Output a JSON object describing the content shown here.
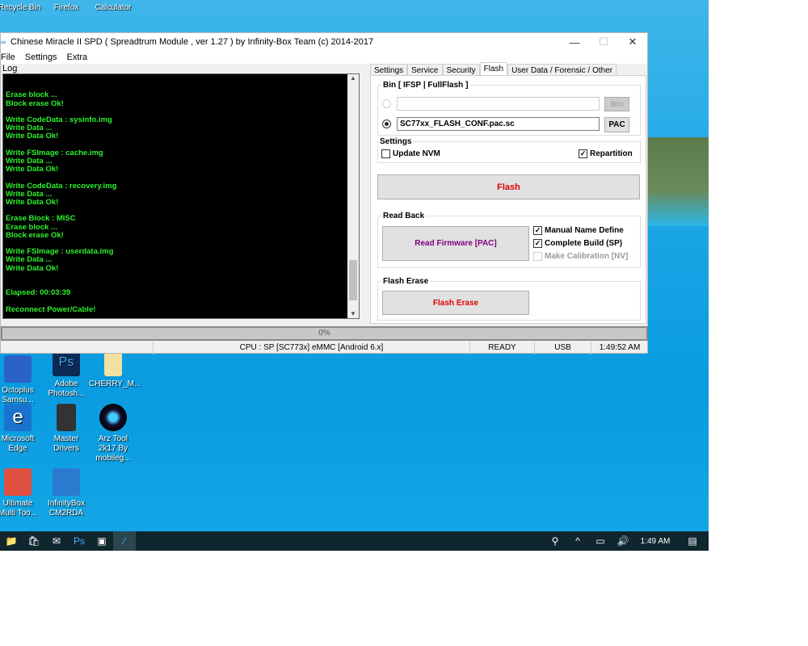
{
  "desktop": {
    "top_icons": [
      "Recycle Bin",
      "Firefox",
      "Calculator"
    ],
    "icons": [
      [
        "Octoplus Samsu...",
        "Adobe Photosh...",
        "CHERRY_M..."
      ],
      [
        "Microsoft Edge",
        "Master Drivers",
        "Arz Tool 2k17 By mobileg..."
      ],
      [
        "Ultimate Multi Too...",
        "InfinityBox CM2RDA",
        ""
      ]
    ]
  },
  "window": {
    "title": "Chinese Miracle II SPD ( Spreadtrum Module , ver 1.27 ) by Infinity-Box Team (c) 2014-2017",
    "menu": [
      "File",
      "Settings",
      "Extra"
    ],
    "log_label": "Log",
    "log_lines": [
      "Erase block ...",
      "Block erase Ok!",
      "",
      "Write CodeData : sysinfo.img",
      "Write Data ...",
      "Write Data Ok!",
      "",
      "Write FSImage : cache.img",
      "Write Data ...",
      "Write Data Ok!",
      "",
      "Write CodeData : recovery.img",
      "Write Data ...",
      "Write Data Ok!",
      "",
      "Erase Block : MISC",
      "Erase block ...",
      "Block erase Ok!",
      "",
      "Write FSImage : userdata.img",
      "Write Data ...",
      "Write Data Ok!",
      "",
      "",
      "Elapsed: 00:03:39",
      "",
      "Reconnect Power/Cable!"
    ],
    "tabs": [
      "Settings",
      "Service",
      "Security",
      "Flash",
      "User Data / Forensic / Other"
    ],
    "active_tab": "Flash",
    "bin_group": "Bin  [ IFSP | FullFlash ]",
    "bin_path": "",
    "bin_button": "Bin",
    "pac_path": "SC77xx_FLASH_CONF.pac.sc",
    "pac_button": "PAC",
    "settings_group": "Settings",
    "update_nvm": "Update NVM",
    "update_nvm_checked": false,
    "repartition": "Repartition",
    "repartition_checked": true,
    "flash_button": "Flash",
    "readback_group": "Read Back",
    "read_firmware_button": "Read Firmware [PAC]",
    "manual_name": "Manual Name Define",
    "complete_build": "Complete Build (SP)",
    "make_calibration": "Make Calibration [NV]",
    "flash_erase_group": "Flash Erase",
    "flash_erase_button": "Flash Erase",
    "progress": "0%",
    "status": {
      "cpu": "CPU : SP [SC773x] eMMC [Android 6.x]",
      "state": "READY",
      "port": "USB",
      "time": "1:49:52 AM"
    }
  },
  "taskbar": {
    "clock": "1:49 AM"
  },
  "colors": {
    "log_text": "#2ef12e",
    "flash_red": "#e00000",
    "read_purple": "#800080"
  }
}
